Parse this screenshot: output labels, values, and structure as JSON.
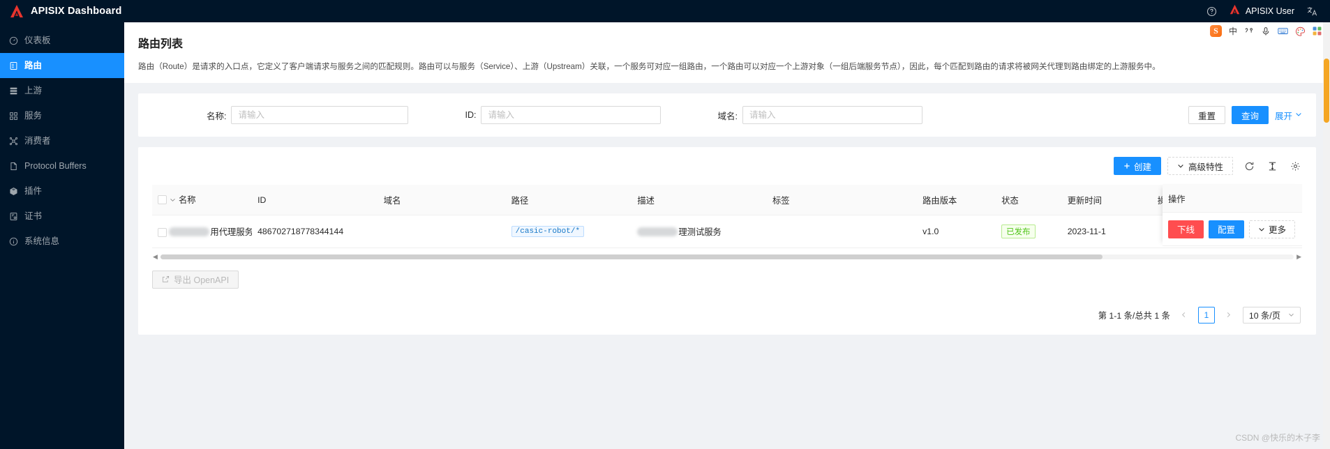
{
  "sidebar": {
    "logo_title": "APISIX Dashboard",
    "items": [
      {
        "label": "仪表板",
        "icon": "dashboard-icon",
        "active": false
      },
      {
        "label": "路由",
        "icon": "route-icon",
        "active": true
      },
      {
        "label": "上游",
        "icon": "upstream-icon",
        "active": false
      },
      {
        "label": "服务",
        "icon": "service-icon",
        "active": false
      },
      {
        "label": "消费者",
        "icon": "consumer-icon",
        "active": false
      },
      {
        "label": "Protocol Buffers",
        "icon": "file-icon",
        "active": false
      },
      {
        "label": "插件",
        "icon": "plugin-icon",
        "active": false
      },
      {
        "label": "证书",
        "icon": "certificate-icon",
        "active": false
      },
      {
        "label": "系统信息",
        "icon": "info-icon",
        "active": false
      }
    ]
  },
  "header": {
    "help_icon": "question-circle-icon",
    "user_name": "APISIX User",
    "locale_icon": "translate-icon"
  },
  "page": {
    "title": "路由列表",
    "description": "路由（Route）是请求的入口点，它定义了客户端请求与服务之间的匹配规则。路由可以与服务（Service）、上游（Upstream）关联，一个服务可对应一组路由，一个路由可以对应一个上游对象（一组后端服务节点），因此，每个匹配到路由的请求将被网关代理到路由绑定的上游服务中。"
  },
  "search": {
    "name_label": "名称:",
    "name_value": "",
    "name_placeholder": "请输入",
    "id_label": "ID:",
    "id_value": "",
    "id_placeholder": "请输入",
    "host_label": "域名:",
    "host_value": "",
    "host_placeholder": "请输入",
    "reset_label": "重置",
    "query_label": "查询",
    "expand_label": "展开"
  },
  "toolbar": {
    "create_label": "创建",
    "create_icon": "plus-icon",
    "advanced_label": "高级特性",
    "advanced_icon": "chevron-down-icon",
    "refresh_icon": "reload-icon",
    "density_icon": "column-height-icon",
    "settings_icon": "gear-icon"
  },
  "table": {
    "columns": [
      "名称",
      "ID",
      "域名",
      "路径",
      "描述",
      "标签",
      "路由版本",
      "状态",
      "更新时间",
      "操作"
    ],
    "rows": [
      {
        "name_redacted": true,
        "name": "用代理服务",
        "id": "486702718778344144",
        "host": "",
        "path": "/casic-robot/*",
        "desc_redacted": true,
        "desc": "理测试服务",
        "labels": "",
        "version": "v1.0",
        "status": "已发布",
        "updated": "2023-11-1",
        "actions": {
          "offline_label": "下线",
          "config_label": "配置",
          "more_label": "更多",
          "more_icon": "chevron-down-icon"
        }
      }
    ]
  },
  "footer": {
    "export_label": "导出 OpenAPI",
    "export_icon": "export-icon",
    "pagination_total": "第 1-1 条/总共 1 条",
    "current_page": "1",
    "page_size": "10 条/页",
    "prev_icon": "chevron-left-icon",
    "next_icon": "chevron-right-icon"
  },
  "ime": {
    "logo": "S",
    "mode_label": "中",
    "punct_icon": "punctuation-icon",
    "voice_icon": "microphone-icon",
    "keyboard_icon": "keyboard-icon",
    "skin_icon": "palette-icon",
    "apps_icon": "grid-icon"
  },
  "watermark": "CSDN @快乐的木子李"
}
